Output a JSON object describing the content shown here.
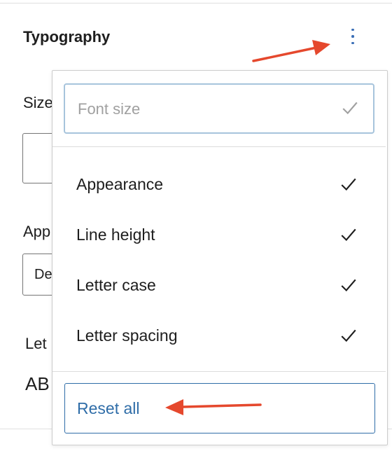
{
  "panel": {
    "title": "Typography",
    "kebab_icon": "more-vertical-icon",
    "accent_color": "#3b6fb6"
  },
  "background_fragments": {
    "size_label": "Size",
    "appearance_label": "App",
    "appearance_value": "De",
    "letter_label": "Let",
    "case_value": "AB"
  },
  "menu": {
    "selected_item": {
      "label": "Font size",
      "checked": true
    },
    "items": [
      {
        "label": "Appearance",
        "checked": true
      },
      {
        "label": "Line height",
        "checked": true
      },
      {
        "label": "Letter case",
        "checked": true
      },
      {
        "label": "Letter spacing",
        "checked": true
      }
    ],
    "reset_label": "Reset all"
  },
  "annotation": {
    "arrow_color": "#e5482d"
  }
}
